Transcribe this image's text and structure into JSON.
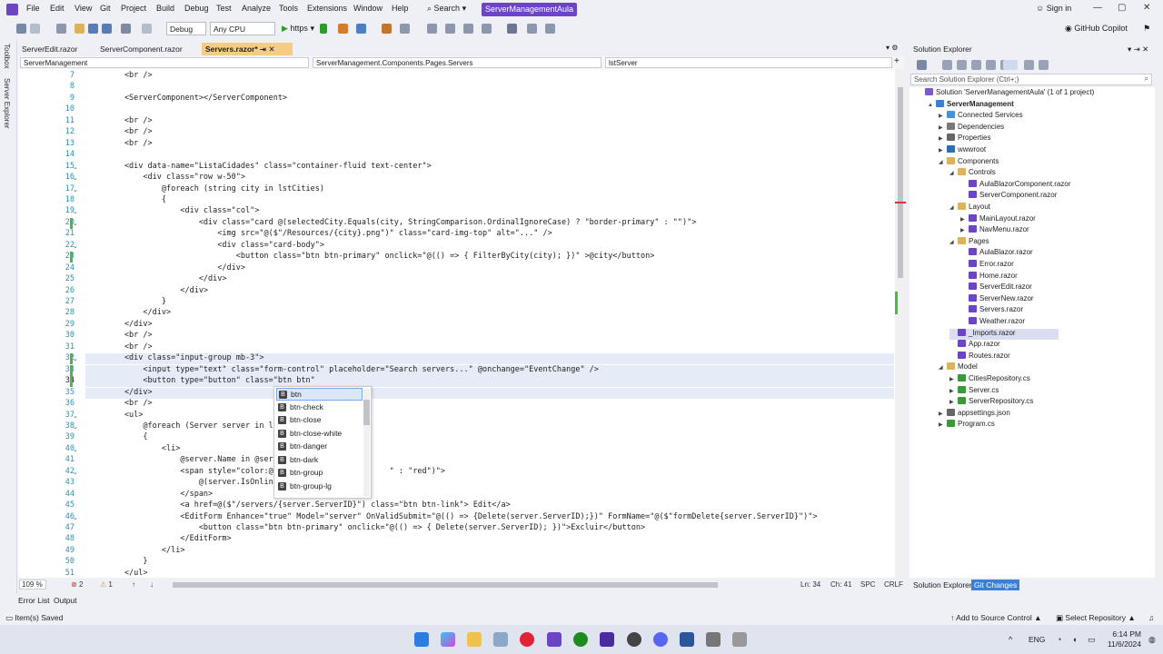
{
  "menu": [
    "File",
    "Edit",
    "View",
    "Git",
    "Project",
    "Build",
    "Debug",
    "Test",
    "Analyze",
    "Tools",
    "Extensions",
    "Window",
    "Help"
  ],
  "search_label": "Search",
  "solution_name": "ServerManagementAula",
  "sign_in": "Sign in",
  "toolbar": {
    "config": "Debug",
    "platform": "Any CPU",
    "run_label": "https",
    "copilot": "GitHub Copilot"
  },
  "left_rail": [
    "Toolbox",
    "Server Explorer"
  ],
  "tabs": [
    "ServerEdit.razor",
    "ServerComponent.razor",
    "Servers.razor*"
  ],
  "nav": {
    "project": "ServerManagement",
    "type": "ServerManagement.Components.Pages.Servers",
    "member": "lstServer"
  },
  "lines": [
    {
      "n": "7",
      "t": "        <br />"
    },
    {
      "n": "8",
      "t": ""
    },
    {
      "n": "9",
      "t": "        <ServerComponent></ServerComponent>"
    },
    {
      "n": "10",
      "t": ""
    },
    {
      "n": "11",
      "t": "        <br />"
    },
    {
      "n": "12",
      "t": "        <br />"
    },
    {
      "n": "13",
      "t": "        <br />"
    },
    {
      "n": "14",
      "t": ""
    },
    {
      "n": "15",
      "t": "        <div data-name=\"ListaCidades\" class=\"container-fluid text-center\">"
    },
    {
      "n": "16",
      "t": "            <div class=\"row w-50\">"
    },
    {
      "n": "17",
      "t": "                @foreach (string city in lstCities)"
    },
    {
      "n": "18",
      "t": "                {"
    },
    {
      "n": "19",
      "t": "                    <div class=\"col\">"
    },
    {
      "n": "20",
      "t": "                        <div class=\"card @(selectedCity.Equals(city, StringComparison.OrdinalIgnoreCase) ? \"border-primary\" : \"\")\">"
    },
    {
      "n": "21",
      "t": "                            <img src=\"@($\"/Resources/{city}.png\")\" class=\"card-img-top\" alt=\"...\" />"
    },
    {
      "n": "22",
      "t": "                            <div class=\"card-body\">"
    },
    {
      "n": "23",
      "t": "                                <button class=\"btn btn-primary\" onclick=\"@(() => { FilterByCity(city); })\" >@city</button>"
    },
    {
      "n": "24",
      "t": "                            </div>"
    },
    {
      "n": "25",
      "t": "                        </div>"
    },
    {
      "n": "26",
      "t": "                    </div>"
    },
    {
      "n": "27",
      "t": "                }"
    },
    {
      "n": "28",
      "t": "            </div>"
    },
    {
      "n": "29",
      "t": "        </div>"
    },
    {
      "n": "30",
      "t": "        <br />"
    },
    {
      "n": "31",
      "t": "        <br />"
    },
    {
      "n": "32",
      "t": "        <div class=\"input-group mb-3\">"
    },
    {
      "n": "33",
      "t": "            <input type=\"text\" class=\"form-control\" placeholder=\"Search servers...\" @onchange=\"EventChange\" />"
    },
    {
      "n": "34",
      "t": "            <button type=\"button\" class=\"btn btn\""
    },
    {
      "n": "35",
      "t": "        </div>"
    },
    {
      "n": "36",
      "t": "        <br />"
    },
    {
      "n": "37",
      "t": "        <ul>"
    },
    {
      "n": "38",
      "t": "            @foreach (Server server in lstSer"
    },
    {
      "n": "39",
      "t": "            {"
    },
    {
      "n": "40",
      "t": "                <li>"
    },
    {
      "n": "41",
      "t": "                    @server.Name in @server.C"
    },
    {
      "n": "42",
      "t": "                    <span style=\"color:@(serv                    \" : \"red\")\">"
    },
    {
      "n": "43",
      "t": "                        @(server.IsOnline ? \""
    },
    {
      "n": "44",
      "t": "                    </span>"
    },
    {
      "n": "45",
      "t": "                    <a href=@($\"/servers/{server.ServerID}\") class=\"btn btn-link\"> Edit</a>"
    },
    {
      "n": "46",
      "t": "                    <EditForm Enhance=\"true\" Model=\"server\" OnValidSubmit=\"@(() => {Delete(server.ServerID);})\" FormName=\"@($\"formDelete{server.ServerID}\")\">"
    },
    {
      "n": "47",
      "t": "                        <button class=\"btn btn-primary\" onclick=\"@(() => { Delete(server.ServerID); })\">Excluir</button>"
    },
    {
      "n": "48",
      "t": "                    </EditForm>"
    },
    {
      "n": "49",
      "t": "                </li>"
    },
    {
      "n": "50",
      "t": "            }"
    },
    {
      "n": "51",
      "t": "        </ul>"
    }
  ],
  "intellisense": [
    "btn",
    "btn-check",
    "btn-close",
    "btn-close-white",
    "btn-danger",
    "btn-dark",
    "btn-group",
    "btn-group-lg"
  ],
  "editor_status": {
    "zoom": "109 %",
    "errors": "2",
    "warnings": "1",
    "ln": "Ln: 34",
    "ch": "Ch: 41",
    "spc": "SPC",
    "eol": "CRLF"
  },
  "bottom_tabs": [
    "Error List",
    "Output"
  ],
  "solution_explorer": {
    "title": "Solution Explorer",
    "search_placeholder": "Search Solution Explorer (Ctrl+;)",
    "tree": [
      {
        "label": "Solution 'ServerManagementAula' (1 of 1 project)",
        "d": 0,
        "tw": "",
        "c": "#7a5cc4"
      },
      {
        "label": "ServerManagement",
        "d": 1,
        "tw": "▲",
        "c": "#3c7fd6",
        "bold": true
      },
      {
        "label": "Connected Services",
        "d": 2,
        "tw": "▶",
        "c": "#4a90d9"
      },
      {
        "label": "Dependencies",
        "d": 2,
        "tw": "▶",
        "c": "#7a7a7a"
      },
      {
        "label": "Properties",
        "d": 2,
        "tw": "▶",
        "c": "#666"
      },
      {
        "label": "wwwroot",
        "d": 2,
        "tw": "▶",
        "c": "#2f6db5"
      },
      {
        "label": "Components",
        "d": 2,
        "tw": "◢",
        "c": "#dcb35c"
      },
      {
        "label": "Controls",
        "d": 3,
        "tw": "◢",
        "c": "#dcb35c"
      },
      {
        "label": "AulaBlazorComponent.razor",
        "d": 4,
        "tw": "",
        "c": "#6b45c4"
      },
      {
        "label": "ServerComponent.razor",
        "d": 4,
        "tw": "",
        "c": "#6b45c4"
      },
      {
        "label": "Layout",
        "d": 3,
        "tw": "◢",
        "c": "#dcb35c"
      },
      {
        "label": "MainLayout.razor",
        "d": 4,
        "tw": "▶",
        "c": "#6b45c4"
      },
      {
        "label": "NavMenu.razor",
        "d": 4,
        "tw": "▶",
        "c": "#6b45c4"
      },
      {
        "label": "Pages",
        "d": 3,
        "tw": "◢",
        "c": "#dcb35c"
      },
      {
        "label": "AulaBlazor.razor",
        "d": 4,
        "tw": "",
        "c": "#6b45c4"
      },
      {
        "label": "Error.razor",
        "d": 4,
        "tw": "",
        "c": "#6b45c4"
      },
      {
        "label": "Home.razor",
        "d": 4,
        "tw": "",
        "c": "#6b45c4"
      },
      {
        "label": "ServerEdit.razor",
        "d": 4,
        "tw": "",
        "c": "#6b45c4"
      },
      {
        "label": "ServerNew.razor",
        "d": 4,
        "tw": "",
        "c": "#6b45c4"
      },
      {
        "label": "Servers.razor",
        "d": 4,
        "tw": "",
        "c": "#6b45c4"
      },
      {
        "label": "Weather.razor",
        "d": 4,
        "tw": "",
        "c": "#6b45c4"
      },
      {
        "label": "_Imports.razor",
        "d": 3,
        "tw": "",
        "c": "#6b45c4",
        "sel": true
      },
      {
        "label": "App.razor",
        "d": 3,
        "tw": "",
        "c": "#6b45c4"
      },
      {
        "label": "Routes.razor",
        "d": 3,
        "tw": "",
        "c": "#6b45c4"
      },
      {
        "label": "Model",
        "d": 2,
        "tw": "◢",
        "c": "#dcb35c"
      },
      {
        "label": "CitiesRepository.cs",
        "d": 3,
        "tw": "▶",
        "c": "#3a9a3a"
      },
      {
        "label": "Server.cs",
        "d": 3,
        "tw": "▶",
        "c": "#3a9a3a"
      },
      {
        "label": "ServerRepository.cs",
        "d": 3,
        "tw": "▶",
        "c": "#3a9a3a"
      },
      {
        "label": "appsettings.json",
        "d": 2,
        "tw": "▶",
        "c": "#666"
      },
      {
        "label": "Program.cs",
        "d": 2,
        "tw": "▶",
        "c": "#3a9a3a"
      }
    ],
    "tabs": [
      "Solution Explorer",
      "Git Changes"
    ]
  },
  "status": {
    "left": "Item(s) Saved",
    "source_control": "Add to Source Control",
    "repo": "Select Repository"
  },
  "tray": {
    "lang": "ENG",
    "time": "6:14 PM",
    "date": "11/6/2024"
  }
}
